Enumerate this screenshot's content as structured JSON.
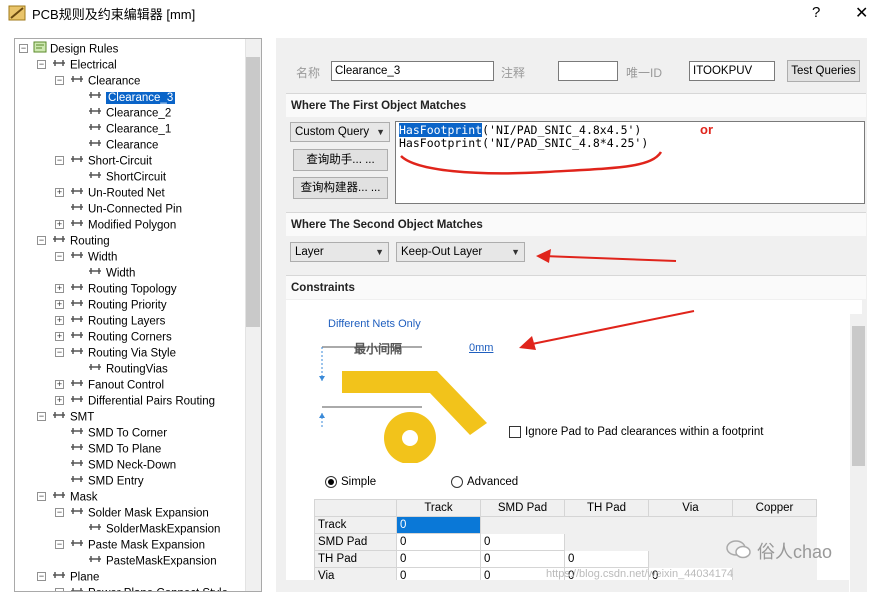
{
  "window": {
    "title": "PCB规则及约束编辑器 [mm]",
    "help": "?",
    "close": "✕"
  },
  "tree": [
    {
      "label": "Design Rules",
      "level": 0,
      "exp": "-"
    },
    {
      "label": "Electrical",
      "level": 1,
      "exp": "-"
    },
    {
      "label": "Clearance",
      "level": 2,
      "exp": "-"
    },
    {
      "label": "Clearance_3",
      "level": 3,
      "selected": true
    },
    {
      "label": "Clearance_2",
      "level": 3
    },
    {
      "label": "Clearance_1",
      "level": 3
    },
    {
      "label": "Clearance",
      "level": 3
    },
    {
      "label": "Short-Circuit",
      "level": 2,
      "exp": "-"
    },
    {
      "label": "ShortCircuit",
      "level": 3
    },
    {
      "label": "Un-Routed Net",
      "level": 2,
      "exp": "+"
    },
    {
      "label": "Un-Connected Pin",
      "level": 2
    },
    {
      "label": "Modified Polygon",
      "level": 2,
      "exp": "+"
    },
    {
      "label": "Routing",
      "level": 1,
      "exp": "-"
    },
    {
      "label": "Width",
      "level": 2,
      "exp": "-"
    },
    {
      "label": "Width",
      "level": 3
    },
    {
      "label": "Routing Topology",
      "level": 2,
      "exp": "+"
    },
    {
      "label": "Routing Priority",
      "level": 2,
      "exp": "+"
    },
    {
      "label": "Routing Layers",
      "level": 2,
      "exp": "+"
    },
    {
      "label": "Routing Corners",
      "level": 2,
      "exp": "+"
    },
    {
      "label": "Routing Via Style",
      "level": 2,
      "exp": "-"
    },
    {
      "label": "RoutingVias",
      "level": 3
    },
    {
      "label": "Fanout Control",
      "level": 2,
      "exp": "+"
    },
    {
      "label": "Differential Pairs Routing",
      "level": 2,
      "exp": "+"
    },
    {
      "label": "SMT",
      "level": 1,
      "exp": "-"
    },
    {
      "label": "SMD To Corner",
      "level": 2
    },
    {
      "label": "SMD To Plane",
      "level": 2
    },
    {
      "label": "SMD Neck-Down",
      "level": 2
    },
    {
      "label": "SMD Entry",
      "level": 2
    },
    {
      "label": "Mask",
      "level": 1,
      "exp": "-"
    },
    {
      "label": "Solder Mask Expansion",
      "level": 2,
      "exp": "-"
    },
    {
      "label": "SolderMaskExpansion",
      "level": 3
    },
    {
      "label": "Paste Mask Expansion",
      "level": 2,
      "exp": "-"
    },
    {
      "label": "PasteMaskExpansion",
      "level": 3
    },
    {
      "label": "Plane",
      "level": 1,
      "exp": "-"
    },
    {
      "label": "Power Plane Connect Style",
      "level": 2,
      "exp": "-"
    }
  ],
  "header": {
    "name_label": "名称",
    "name_value": "Clearance_3",
    "comment_label": "注释",
    "comment_value": "",
    "uid_label": "唯一ID",
    "uid_value": "ITOOKPUV",
    "test_queries": "Test Queries"
  },
  "first_match": {
    "heading": "Where The First Object Matches",
    "combo": "Custom Query",
    "helper_btn": "查询助手... ...",
    "builder_btn": "查询构建器... ...",
    "query_kw": "HasFootprint",
    "query_line1_rest": "('NI/PAD_SNIC_4.8x4.5')",
    "query_line2": "HasFootprint('NI/PAD_SNIC_4.8*4.25')",
    "annotation_or": "or"
  },
  "second_match": {
    "heading": "Where The Second Object Matches",
    "combo1": "Layer",
    "combo2": "Keep-Out Layer"
  },
  "constraints": {
    "heading": "Constraints",
    "diff_nets": "Different Nets Only",
    "min_clearance_label": "最小间隔",
    "min_clearance_value": "0mm",
    "ignore_pad": "Ignore Pad to Pad clearances within a footprint",
    "simple": "Simple",
    "advanced": "Advanced",
    "columns": [
      "Track",
      "SMD Pad",
      "TH Pad",
      "Via",
      "Copper"
    ],
    "rows": [
      {
        "name": "Track",
        "values": [
          "0"
        ]
      },
      {
        "name": "SMD Pad",
        "values": [
          "0",
          "0"
        ]
      },
      {
        "name": "TH Pad",
        "values": [
          "0",
          "0",
          "0"
        ]
      },
      {
        "name": "Via",
        "values": [
          "0",
          "0",
          "0",
          "0"
        ]
      }
    ]
  },
  "watermark": {
    "brand": "俗人chao",
    "url": "https://blog.csdn.net/weixin_44034174"
  },
  "colors": {
    "accent": "#0a64c8",
    "annotation_red": "#e0241b",
    "pad_yellow": "#f2c31b"
  }
}
